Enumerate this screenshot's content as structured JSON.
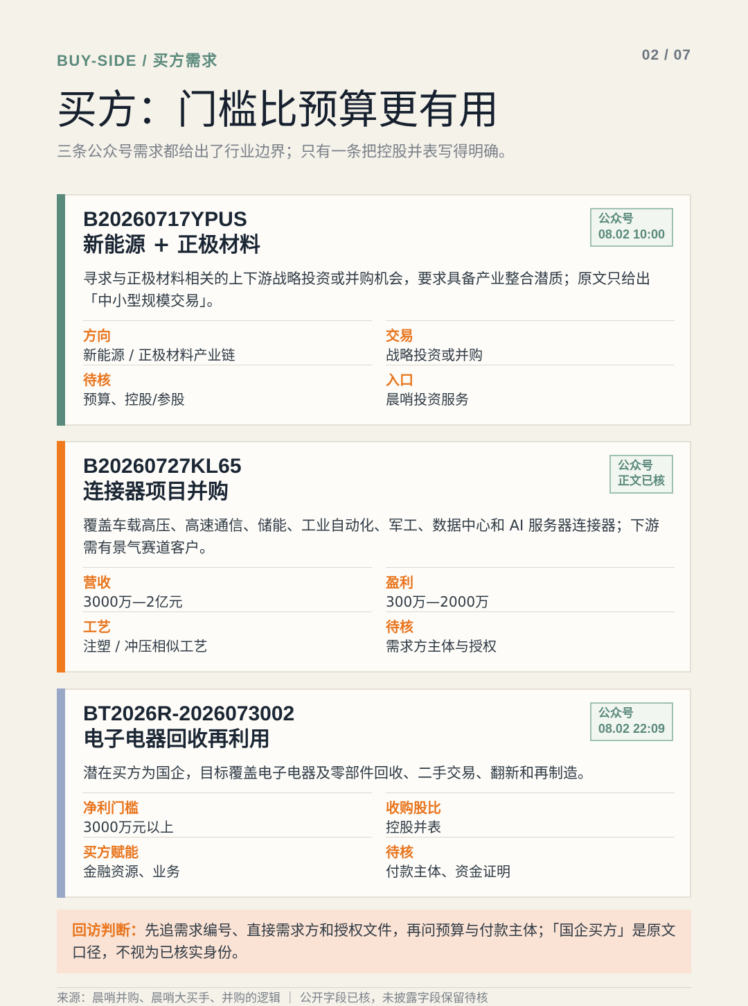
{
  "header": {
    "kicker": "BUY-SIDE / 买方需求",
    "page_indicator": "02 / 07",
    "title": "买方：门槛比预算更有用",
    "subtitle": "三条公众号需求都给出了行业边界；只有一条把控股并表写得明确。"
  },
  "colors": {
    "accent_green": "#5a8a7c",
    "accent_orange": "#f07a1e",
    "accent_slate": "#9aa8c8",
    "label_orange": "#e8751e",
    "note_bg": "#fae2d4",
    "page_bg": "#f5f2ea"
  },
  "cards": [
    {
      "id": "B20260717YPUS",
      "name": "新能源 + 正极材料",
      "badge_line1": "公众号",
      "badge_line2": "08.02 10:00",
      "description": "寻求与正极材料相关的上下游战略投资或并购机会，要求具备产业整合潜质；原文只给出「中小型规模交易」。",
      "fields": [
        {
          "label": "方向",
          "value": "新能源 / 正极材料产业链"
        },
        {
          "label": "交易",
          "value": "战略投资或并购"
        },
        {
          "label": "待核",
          "value": "预算、控股/参股"
        },
        {
          "label": "入口",
          "value": "晨哨投资服务"
        }
      ]
    },
    {
      "id": "B20260727KL65",
      "name": "连接器项目并购",
      "badge_line1": "公众号",
      "badge_line2": "正文已核",
      "description": "覆盖车载高压、高速通信、储能、工业自动化、军工、数据中心和 AI 服务器连接器；下游需有景气赛道客户。",
      "fields": [
        {
          "label": "营收",
          "value": "3000万—2亿元"
        },
        {
          "label": "盈利",
          "value": "300万—2000万"
        },
        {
          "label": "工艺",
          "value": "注塑 / 冲压相似工艺"
        },
        {
          "label": "待核",
          "value": "需求方主体与授权"
        }
      ]
    },
    {
      "id": "BT2026R-2026073002",
      "name": "电子电器回收再利用",
      "badge_line1": "公众号",
      "badge_line2": "08.02 22:09",
      "description": "潜在买方为国企，目标覆盖电子电器及零部件回收、二手交易、翻新和再制造。",
      "fields": [
        {
          "label": "净利门槛",
          "value": "3000万元以上"
        },
        {
          "label": "收购股比",
          "value": "控股并表"
        },
        {
          "label": "买方赋能",
          "value": "金融资源、业务"
        },
        {
          "label": "待核",
          "value": "付款主体、资金证明"
        }
      ]
    }
  ],
  "note": {
    "label": "回访判断：",
    "text": "先追需求编号、直接需求方和授权文件，再问预算与付款主体；「国企买方」是原文口径，不视为已核实身份。"
  },
  "footer": {
    "text": "来源：晨哨并购、晨哨大买手、并购的逻辑 ｜ 公开字段已核，未披露字段保留待核"
  }
}
